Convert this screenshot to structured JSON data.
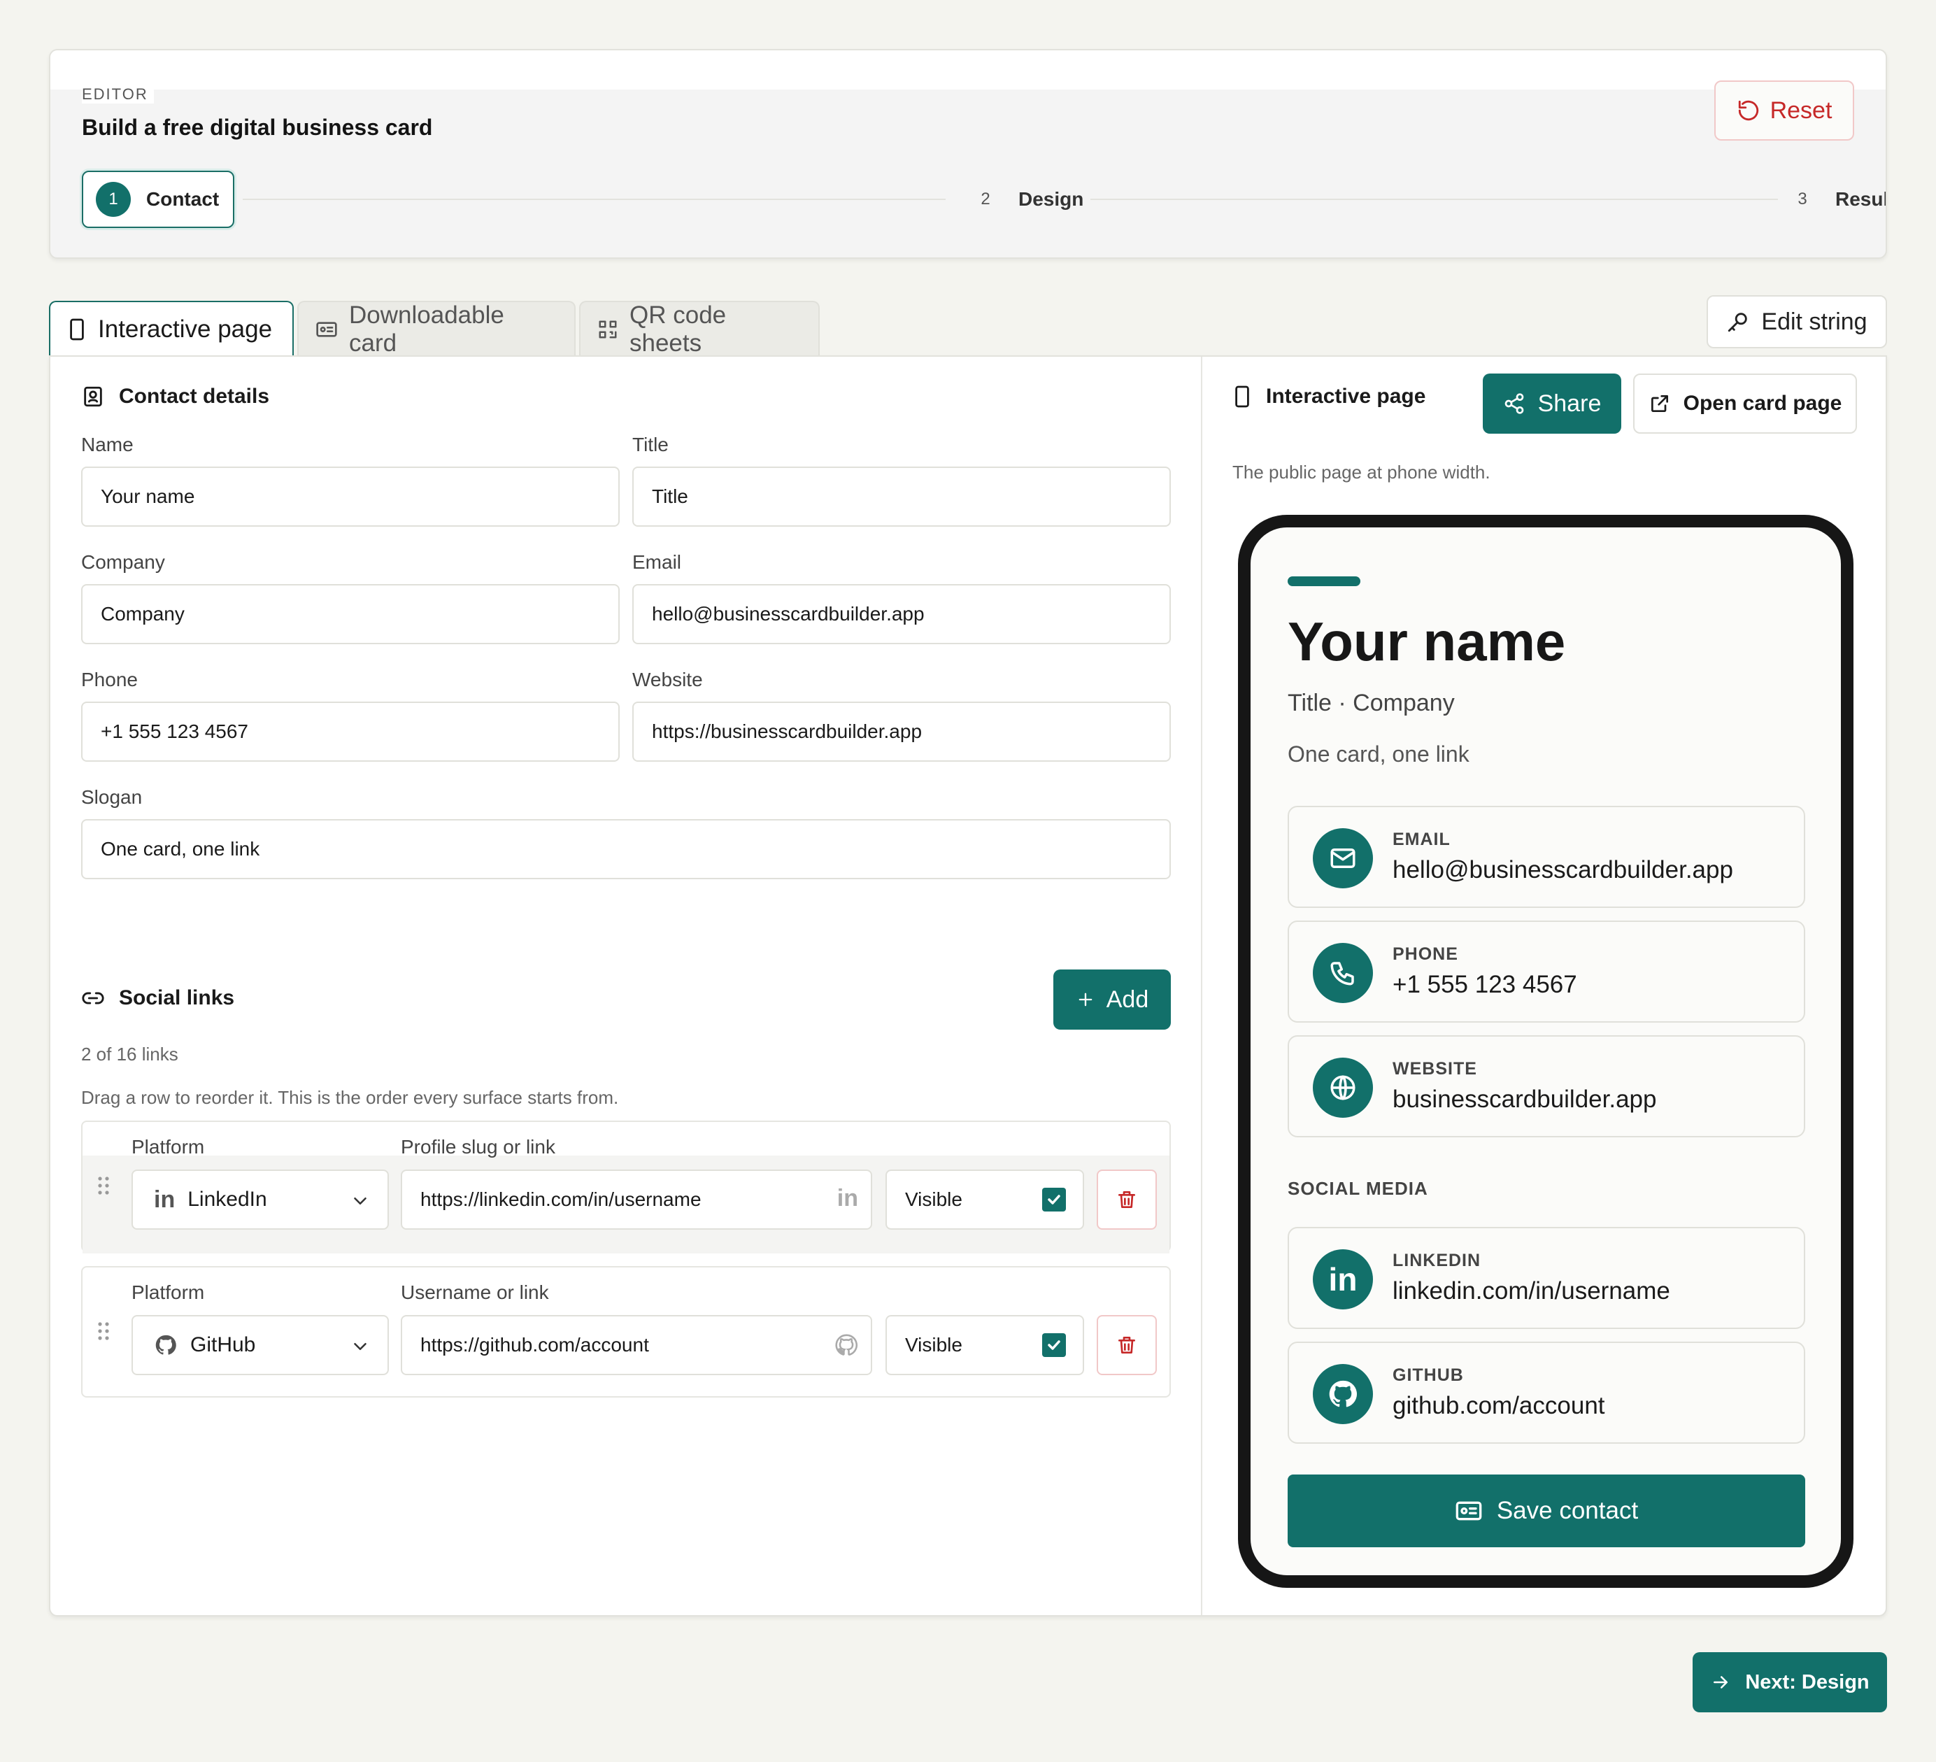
{
  "header": {
    "eyebrow": "EDITOR",
    "title": "Build a free digital business card",
    "reset_label": "Reset",
    "steps": [
      {
        "num": "1",
        "label": "Contact",
        "active": true
      },
      {
        "num": "2",
        "label": "Design",
        "active": false
      },
      {
        "num": "3",
        "label": "Result",
        "active": false
      }
    ]
  },
  "tabs": [
    {
      "label": "Interactive page",
      "icon": "phone-icon",
      "active": true
    },
    {
      "label": "Downloadable card",
      "icon": "id-card-icon",
      "active": false
    },
    {
      "label": "QR code sheets",
      "icon": "qr-code-icon",
      "active": false
    }
  ],
  "edit_string_label": "Edit string",
  "contact_details": {
    "heading": "Contact details",
    "fields": {
      "name": {
        "label": "Name",
        "value": "Your name"
      },
      "title": {
        "label": "Title",
        "value": "Title"
      },
      "company": {
        "label": "Company",
        "value": "Company"
      },
      "email": {
        "label": "Email",
        "value": "hello@businesscardbuilder.app"
      },
      "phone": {
        "label": "Phone",
        "value": "+1 555 123 4567"
      },
      "website": {
        "label": "Website",
        "value": "https://businesscardbuilder.app"
      },
      "slogan": {
        "label": "Slogan",
        "value": "One card, one link"
      }
    }
  },
  "social_links": {
    "heading": "Social links",
    "add_label": "Add",
    "count_text": "2 of 16 links",
    "hint": "Drag a row to reorder it. This is the order every surface starts from.",
    "rows": [
      {
        "platform_label": "Platform",
        "platform": "LinkedIn",
        "platform_icon": "linkedin-icon",
        "link_label": "Profile slug or link",
        "link_value": "https://linkedin.com/in/username",
        "visible_label": "Visible",
        "visible": true
      },
      {
        "platform_label": "Platform",
        "platform": "GitHub",
        "platform_icon": "github-icon",
        "link_label": "Username or link",
        "link_value": "https://github.com/account",
        "visible_label": "Visible",
        "visible": true
      }
    ]
  },
  "preview": {
    "heading": "Interactive page",
    "share_label": "Share",
    "open_label": "Open card page",
    "caption": "The public page at phone width.",
    "card": {
      "name": "Your name",
      "subtitle": "Title · Company",
      "slogan": "One card, one link",
      "contacts": [
        {
          "label": "EMAIL",
          "value": "hello@businesscardbuilder.app",
          "icon": "mail-icon"
        },
        {
          "label": "PHONE",
          "value": "+1 555 123 4567",
          "icon": "phone-call-icon"
        },
        {
          "label": "WEBSITE",
          "value": "businesscardbuilder.app",
          "icon": "globe-icon"
        }
      ],
      "social_heading": "SOCIAL MEDIA",
      "socials": [
        {
          "label": "LINKEDIN",
          "value": "linkedin.com/in/username",
          "icon": "linkedin-icon"
        },
        {
          "label": "GITHUB",
          "value": "github.com/account",
          "icon": "github-icon"
        }
      ],
      "save_label": "Save contact"
    }
  },
  "next_label": "Next: Design",
  "colors": {
    "accent": "#12706a",
    "danger": "#c62828",
    "background": "#f4f4ef"
  }
}
